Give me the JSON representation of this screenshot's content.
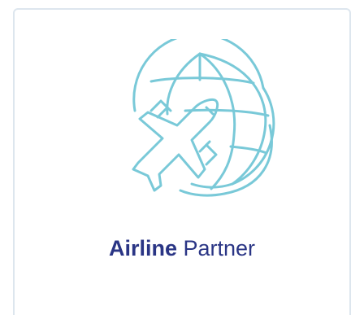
{
  "card": {
    "title_bold": "Airline",
    "title_rest": " Partner",
    "icon": "globe-airplane-icon"
  },
  "colors": {
    "icon_stroke": "#79c9d8",
    "title_text": "#2a3585",
    "card_border": "#dde6ee"
  }
}
